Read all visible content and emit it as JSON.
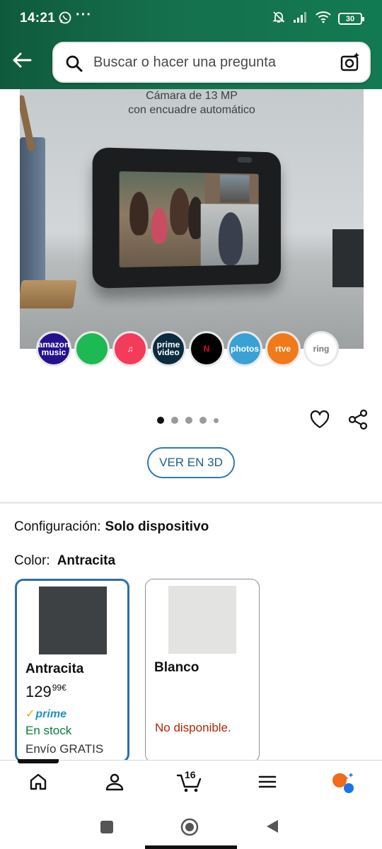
{
  "status_bar": {
    "time": "14:21",
    "more": "···",
    "battery": "30"
  },
  "header": {
    "search_placeholder": "Buscar o hacer una pregunta"
  },
  "product_image": {
    "caption_line1": "Cámara de 13 MP",
    "caption_line2": "con encuadre automático",
    "apps": [
      {
        "label": "amazon music",
        "bg": "#25118f",
        "fg": "#ffffff"
      },
      {
        "label": "",
        "bg": "#1db954",
        "fg": "#000000"
      },
      {
        "label": "♫",
        "bg": "#f43b5a",
        "fg": "#ffffff"
      },
      {
        "label": "prime video",
        "bg": "#0b2b3e",
        "fg": "#ffffff"
      },
      {
        "label": "N",
        "bg": "#000000",
        "fg": "#e50914"
      },
      {
        "label": "photos",
        "bg": "#3aa1d6",
        "fg": "#ffffff"
      },
      {
        "label": "rtve",
        "bg": "#f07a1a",
        "fg": "#ffffff"
      },
      {
        "label": "ring",
        "bg": "#ffffff",
        "fg": "#777777"
      }
    ]
  },
  "image_nav": {
    "pages_total": 5,
    "current_page": 1
  },
  "view_3d_button": "VER EN 3D",
  "configuration": {
    "label": "Configuración:",
    "value": "Solo dispositivo"
  },
  "color": {
    "label": "Color:",
    "value": "Antracita",
    "options": [
      {
        "name": "Antracita",
        "swatch": "#3d4144",
        "price_whole": "129",
        "price_fraction": "99",
        "price_currency": "€",
        "prime": "prime",
        "stock": "En stock",
        "shipping": "Envío GRATIS",
        "selected": true
      },
      {
        "name": "Blanco",
        "swatch": "#e3e3e1",
        "availability": "No disponible.",
        "selected": false
      }
    ]
  },
  "tab_bar": {
    "cart_count": "16"
  },
  "colors": {
    "header_green": "#15704d",
    "accent_blue": "#2f6ea3",
    "in_stock_green": "#067d3a",
    "unavailable_red": "#b12704",
    "prime_blue": "#1e90c8"
  }
}
